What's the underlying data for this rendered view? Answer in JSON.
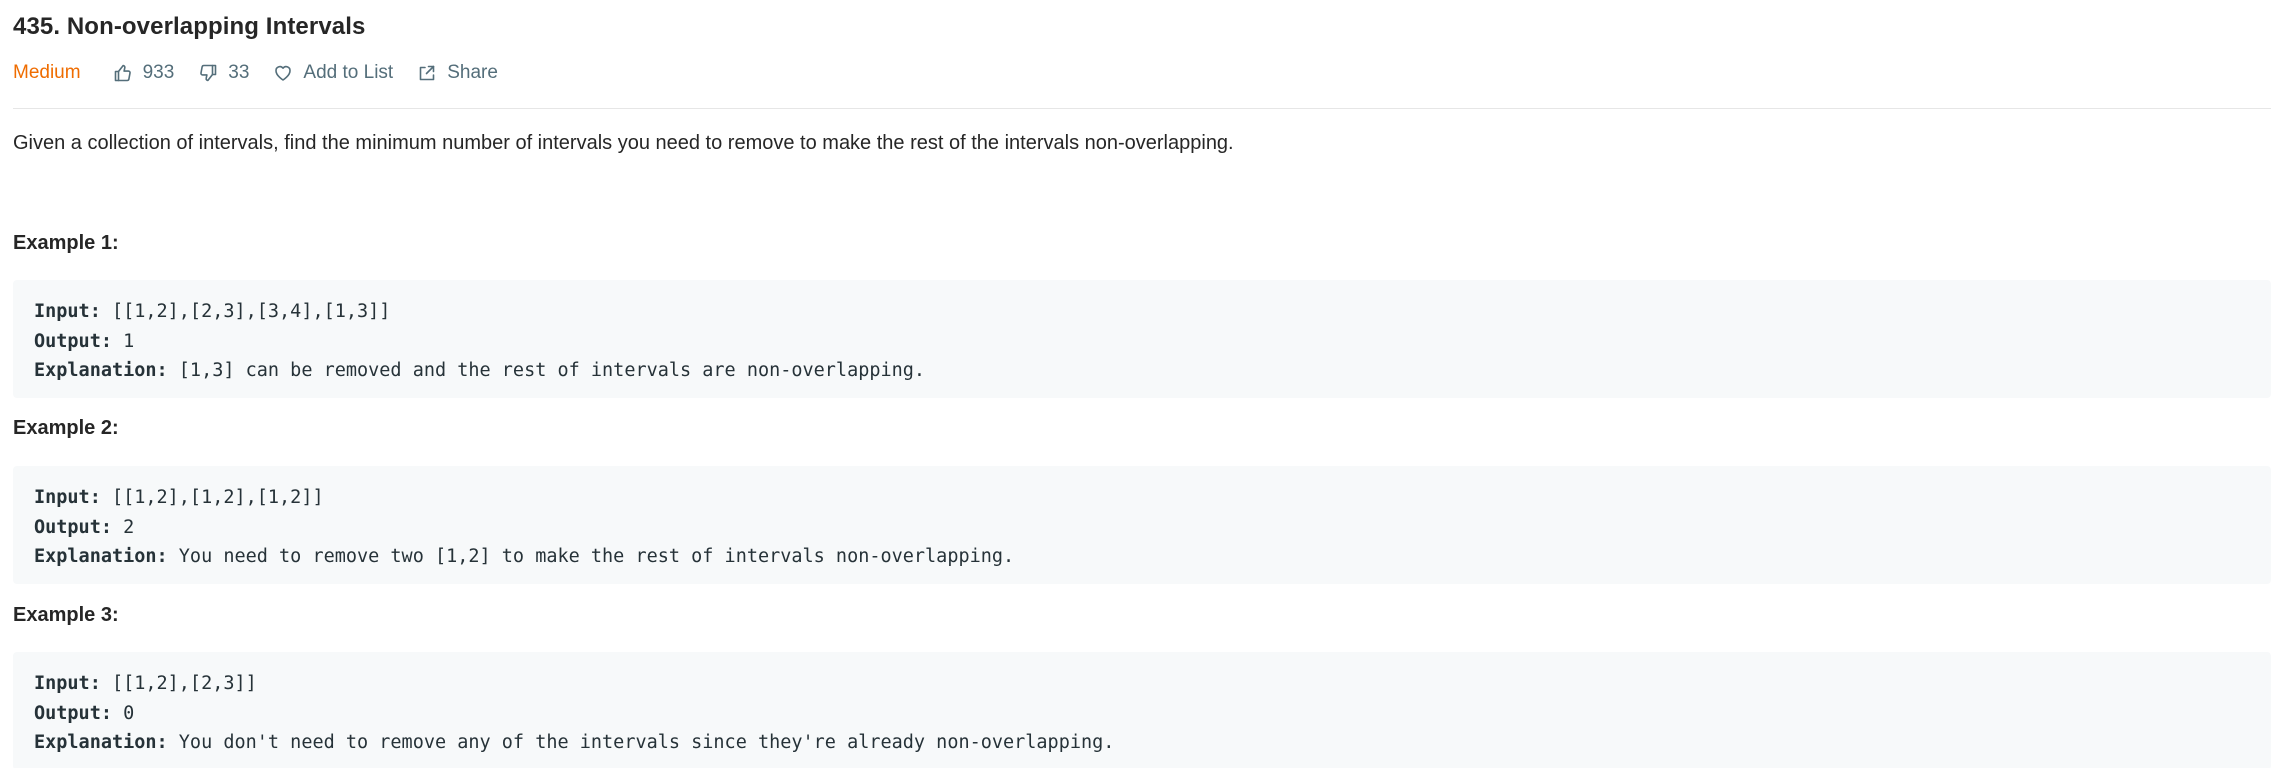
{
  "problem": {
    "title": "435. Non-overlapping Intervals",
    "difficulty": "Medium",
    "likes": "933",
    "dislikes": "33",
    "add_to_list_label": "Add to List",
    "share_label": "Share",
    "description": "Given a collection of intervals, find the minimum number of intervals you need to remove to make the rest of the intervals non-overlapping."
  },
  "labels": {
    "input": "Input:",
    "output": "Output:",
    "explanation": "Explanation:"
  },
  "examples": [
    {
      "title": "Example 1:",
      "input": "[[1,2],[2,3],[3,4],[1,3]]",
      "output": "1",
      "explanation": "[1,3] can be removed and the rest of intervals are non-overlapping."
    },
    {
      "title": "Example 2:",
      "input": "[[1,2],[1,2],[1,2]]",
      "output": "2",
      "explanation": "You need to remove two [1,2] to make the rest of intervals non-overlapping."
    },
    {
      "title": "Example 3:",
      "input": "[[1,2],[2,3]]",
      "output": "0",
      "explanation": "You don't need to remove any of the intervals since they're already non-overlapping."
    }
  ],
  "colors": {
    "difficulty_medium": "#ef6c00",
    "meta_text": "#546e7a",
    "code_background": "#f7f9fa",
    "divider": "#e6e6e6"
  },
  "icons": [
    "thumbs-up-icon",
    "thumbs-down-icon",
    "heart-icon",
    "share-icon"
  ]
}
